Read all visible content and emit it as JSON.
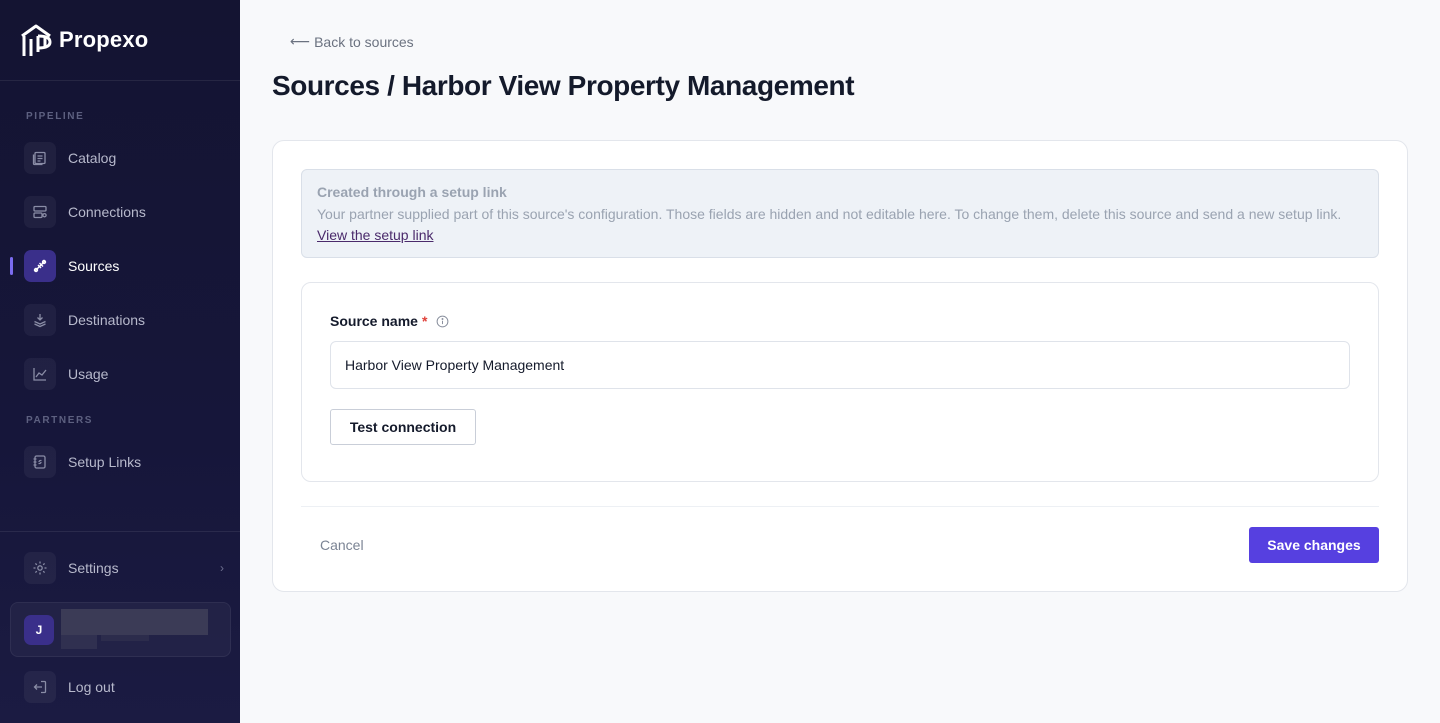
{
  "brand": {
    "name": "Propexo",
    "logo_icon": "propexo-logo-icon"
  },
  "sidebar": {
    "sections": {
      "pipeline": "PIPELINE",
      "partners": "PARTNERS"
    },
    "items": [
      {
        "label": "Catalog",
        "icon": "catalog-icon"
      },
      {
        "label": "Connections",
        "icon": "connections-icon"
      },
      {
        "label": "Sources",
        "icon": "sources-icon",
        "active": true
      },
      {
        "label": "Destinations",
        "icon": "destinations-icon"
      },
      {
        "label": "Usage",
        "icon": "usage-icon"
      },
      {
        "label": "Setup Links",
        "icon": "setup-links-icon"
      }
    ],
    "settings": {
      "label": "Settings",
      "icon": "gear-icon"
    },
    "user": {
      "initial": "J"
    },
    "logout": {
      "label": "Log out",
      "icon": "logout-icon"
    }
  },
  "main": {
    "back_label": "Back to sources",
    "title": "Sources / Harbor View Property Management",
    "notice": {
      "title": "Created through a setup link",
      "body": "Your partner supplied part of this source's configuration. Those fields are hidden and not editable here. To change them, delete this source and send a new setup link.",
      "link_label": "View the setup link"
    },
    "form": {
      "source_name_label": "Source name",
      "required_mark": "*",
      "source_name_value": "Harbor View Property Management",
      "test_button": "Test connection"
    },
    "footer": {
      "cancel_label": "Cancel",
      "save_label": "Save changes"
    }
  },
  "colors": {
    "sidebar_bg": "#141432",
    "accent": "#5640e0",
    "active_icon_bg": "#3a2f8a",
    "required": "#e0413a"
  }
}
